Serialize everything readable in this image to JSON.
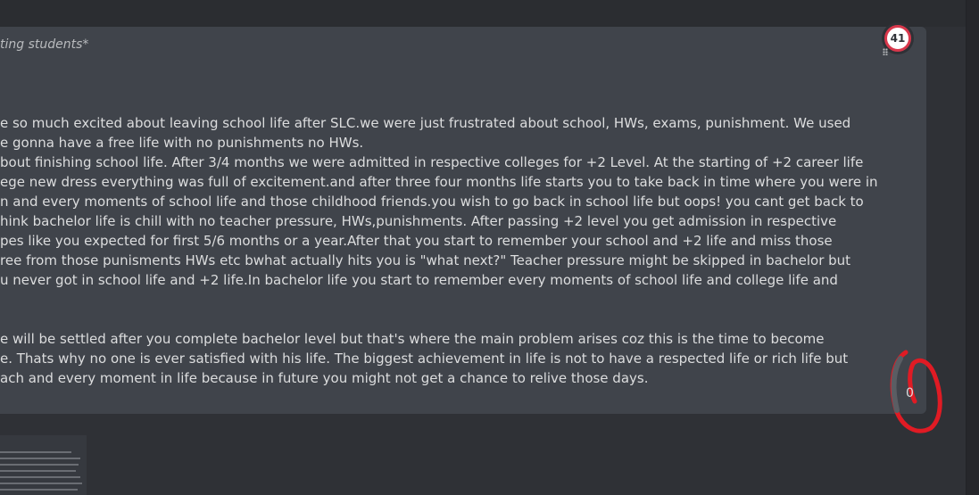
{
  "title": "ting students*",
  "badge": {
    "count": "41"
  },
  "counter": {
    "value": "0"
  },
  "paragraph1": [
    "e so much excited about leaving school life after SLC.we were just frustrated about school, HWs, exams, punishment. We used",
    "e gonna have a free life with no punishments no HWs.",
    "bout finishing school life. After 3/4 months we were admitted in respective colleges for +2 Level. At the starting of +2 career life",
    "ege new dress everything was full of excitement.and after three four months life starts you to take back in time where you were in",
    "n and every moments of school life and those childhood friends.you wish to go back in school life but oops! you cant get back to",
    "hink bachelor life is chill with no teacher pressure, HWs,punishments. After passing +2 level you get admission in respective",
    "pes like you expected for first 5/6 months or a year.After that you start to remember your school and +2 life and miss those",
    "ree from those punisments HWs etc bwhat actually hits you is \"what next?\" Teacher pressure might be skipped in bachelor but",
    "u never got in school life and +2 life.In bachelor life you start to remember every moments of school life and college life and"
  ],
  "paragraph2": [
    "e will be settled after you complete bachelor level but that's where the main problem arises coz this is the time to become",
    "e. Thats why no one is ever satisfied with his life. The biggest achievement in life is not to have a respected life or rich life but",
    "ach and every moment in life because in future you might not get a chance to relive those days."
  ],
  "colors": {
    "panel": "#40444b",
    "background": "#2f3136",
    "spellcheck": "#ed4245",
    "annotation": "#e01b24"
  }
}
